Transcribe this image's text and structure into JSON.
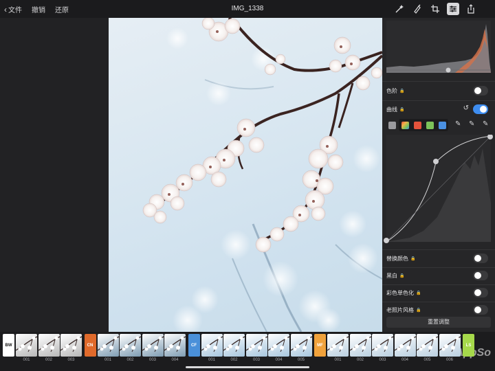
{
  "toolbar": {
    "back_label": "文件",
    "undo_label": "撤销",
    "restore_label": "还原",
    "title": "IMG_1338",
    "icons": [
      "magic-wand-icon",
      "brush-icon",
      "crop-icon",
      "adjust-sliders-icon",
      "share-icon"
    ]
  },
  "panel": {
    "levels_label": "色阶",
    "levels_on": false,
    "curves_label": "曲线",
    "curves_on": true,
    "channel_colors": [
      "#9a9a9e",
      "#f0b24a",
      "#e5533c",
      "#7cc35a",
      "#4a90e2"
    ],
    "replace_color_label": "替换颜色",
    "replace_color_on": false,
    "bw_label": "黑白",
    "bw_on": false,
    "color_mono_label": "彩色单色化",
    "color_mono_on": false,
    "vintage_label": "老照片风格",
    "vintage_on": false,
    "reset_label": "重置调整"
  },
  "filmstrip": {
    "groups": [
      {
        "code": "BW",
        "color": "#ffffff",
        "text_color": "#111111",
        "items": [
          "001",
          "002",
          "003"
        ],
        "tint": "#b8b8b8"
      },
      {
        "code": "CN",
        "color": "#e06a2b",
        "text_color": "#ffffff",
        "items": [
          "001",
          "002",
          "003",
          "004"
        ],
        "tint": "#7f9db3"
      },
      {
        "code": "CF",
        "color": "#4a90d9",
        "text_color": "#ffffff",
        "items": [
          "001",
          "002",
          "003",
          "004",
          "005"
        ],
        "tint": "#a7c6de"
      },
      {
        "code": "MF",
        "color": "#f0a23c",
        "text_color": "#ffffff",
        "items": [
          "001",
          "002",
          "003",
          "004",
          "005",
          "006"
        ],
        "tint": "#b9cfe0"
      },
      {
        "code": "LS",
        "color": "#a6d94b",
        "text_color": "#ffffff",
        "items": [
          ""
        ],
        "tint": "#9fc2e6"
      }
    ],
    "watermark": "AppSo"
  }
}
